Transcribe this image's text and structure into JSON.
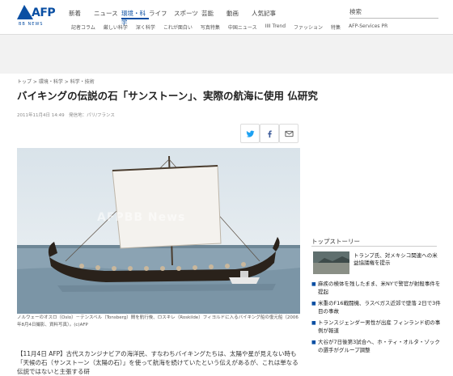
{
  "header": {
    "logo_text": "AFP",
    "logo_sub": "BB NEWS",
    "nav": [
      "新着",
      "ニュース",
      "環境・科学",
      "ライフ",
      "スポーツ",
      "芸能",
      "動画",
      "人気記事"
    ],
    "active_nav_index": 2,
    "search_label": "検索",
    "subnav": [
      "記者コラム",
      "厳しい科学",
      "深く科学",
      "これが面白い",
      "写真特集",
      "中国ニュース",
      "IIII Trend",
      "ファッション",
      "特集",
      "AFP-Services PR"
    ]
  },
  "article": {
    "breadcrumb": "トップ > 環境・科学 > 科学・技術",
    "headline": "バイキングの伝説の石「サンストーン」、実際の航海に使用 仏研究",
    "meta": "2011年11月4日 14:49　発信地：パリ/フランス",
    "watermark": "AFPBB News",
    "caption": "ノルウェーのオスロ（Oslo）－テンスベル（Tonsberg）間を航行後、ロスキレ（Roskilde）フィヨルドに入るバイキング船の復元船（2006年8月4日撮影、資料写真）。(c)AFP",
    "body": "【11月4日 AFP】古代スカンジナビアの海洋民、すなわちバイキングたちは、太陽や星が見えない時も「天候の石（サンストーン（太陽の石）」を使って航海を続けていたという伝えがあるが、これは単なる伝説ではないと主張する研"
  },
  "share": {
    "twitter": "twitter-icon",
    "facebook": "facebook-icon",
    "mail": "mail-icon"
  },
  "sidebar": {
    "title": "トップストーリー",
    "top_story": "トランプ氏、対メキシコ関連への米益協議権を提示",
    "stories": [
      "麻疾の検体を残したまま、米NYで警官が射殺事件を提起",
      "米重のF16戦闘機、ラスベガス近郊で墜落 2日で3件目の事故",
      "トランスジェンダー男性が出産 フィンランド初の事例が報道",
      "大谷が7日後第3試合へ、ホ・ティ・オルタ・ゾックの選手がグループ調整"
    ]
  },
  "colors": {
    "brand": "#0a4fa3",
    "sky": "#e9eef1",
    "sea": "#8aa2b3"
  }
}
